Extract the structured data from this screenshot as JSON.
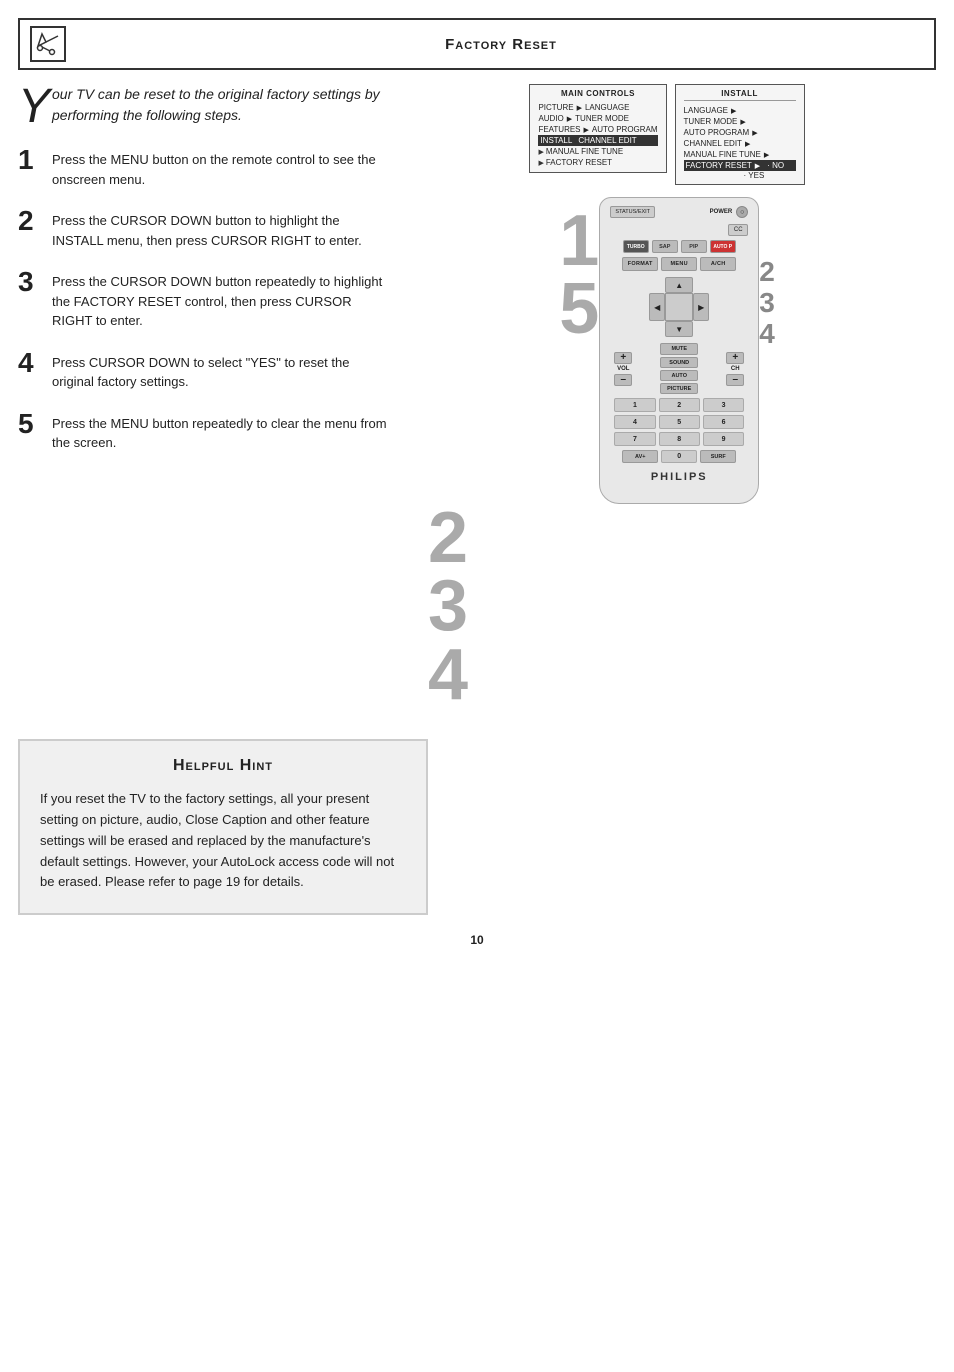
{
  "header": {
    "title": "Factory Reset",
    "icon": "✂"
  },
  "intro": {
    "drop_cap": "Y",
    "text": "our TV can be reset to the original factory settings by performing the following steps."
  },
  "steps": [
    {
      "number": "1",
      "text": "Press the MENU button on the remote control to see the onscreen menu."
    },
    {
      "number": "2",
      "text": "Press the CURSOR DOWN button to highlight the INSTALL menu, then press CURSOR RIGHT to enter."
    },
    {
      "number": "3",
      "text": "Press the CURSOR DOWN button repeatedly to highlight the FACTORY RESET control, then press CURSOR RIGHT to enter."
    },
    {
      "number": "4",
      "text": "Press CURSOR DOWN to select \"YES\" to reset the original factory settings."
    },
    {
      "number": "5",
      "text": "Press the MENU button repeatedly to clear the menu from the screen."
    }
  ],
  "menu_diagram": {
    "title": "MAIN CONTROLS",
    "rows": [
      {
        "label": "PICTURE",
        "arrow": "▶",
        "sub": "LANGUAGE",
        "highlighted": false
      },
      {
        "label": "AUDIO",
        "arrow": "▶",
        "sub": "TUNER MODE",
        "highlighted": false
      },
      {
        "label": "FEATURES",
        "arrow": "▶",
        "sub": "AUTO PROGRAM",
        "highlighted": false
      },
      {
        "label": "INSTALL",
        "arrow": "",
        "sub": "CHANNEL EDIT",
        "highlighted": true
      },
      {
        "label": "",
        "arrow": "▶",
        "sub": "MANUAL FINE TUNE",
        "highlighted": false
      },
      {
        "label": "",
        "arrow": "▶",
        "sub": "FACTORY RESET",
        "highlighted": false
      }
    ]
  },
  "install_diagram": {
    "title": "INSTALL",
    "rows": [
      {
        "label": "LANGUAGE",
        "arrow": "▶",
        "val": ""
      },
      {
        "label": "TUNER MODE",
        "arrow": "▶",
        "val": ""
      },
      {
        "label": "AUTO PROGRAM",
        "arrow": "▶",
        "val": ""
      },
      {
        "label": "CHANNEL EDIT",
        "arrow": "▶",
        "val": ""
      },
      {
        "label": "MANUAL FINE TUNE",
        "arrow": "▶",
        "val": ""
      },
      {
        "label": "FACTORY RESET",
        "arrow": "▶",
        "val": "",
        "highlighted": true
      }
    ],
    "options": [
      {
        "label": "NO"
      },
      {
        "label": "YES",
        "highlighted": true
      }
    ]
  },
  "remote": {
    "brand": "PHILIPS",
    "buttons": {
      "status_exit": "STATUS/EXIT",
      "cc": "CC",
      "power": "⏻",
      "row1": [
        "TURBO",
        "SAP",
        "PIP",
        "AUTOP"
      ],
      "format": "FORMAT",
      "menu": "MENU",
      "axn": "A/CH",
      "up": "▲",
      "down": "▼",
      "left": "◀",
      "right": "▶",
      "mute": "MUTE",
      "vol_plus": "+",
      "vol_minus": "–",
      "ch_plus": "+",
      "ch_minus": "–",
      "vol_label": "VOL",
      "ch_label": "CH",
      "sound": "SOUND",
      "auto": "AUTO",
      "picture": "PICTURE",
      "num1": "1",
      "num2": "2",
      "num3": "3",
      "num4": "4",
      "num5": "5",
      "num6": "6",
      "num7": "7",
      "num8": "8",
      "num9": "9",
      "av": "AV+",
      "zero": "0",
      "surf": "SURF"
    }
  },
  "hint": {
    "title": "Helpful Hint",
    "text": "If you reset the TV to the factory settings, all your present setting on picture, audio, Close Caption and other feature settings will be erased and replaced by the manufacture's default settings. However, your AutoLock access code will not be erased. Please refer to page 19 for details."
  },
  "page_number": "10",
  "overlay_numbers": {
    "top_left_1": "1",
    "top_left_5": "5",
    "right_2": "2",
    "right_3": "3",
    "right_4": "4",
    "bottom_2": "2",
    "bottom_3": "3",
    "bottom_4": "4"
  }
}
